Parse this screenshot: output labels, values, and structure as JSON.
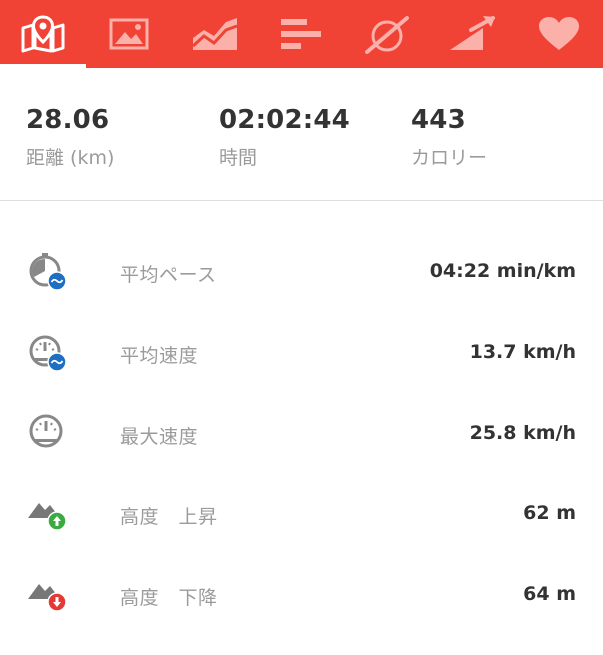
{
  "tabs": [
    {
      "icon": "map-pin-icon",
      "active": true
    },
    {
      "icon": "photo-icon",
      "active": false
    },
    {
      "icon": "area-chart-icon",
      "active": false
    },
    {
      "icon": "splits-bars-icon",
      "active": false
    },
    {
      "icon": "pace-gauge-icon",
      "active": false
    },
    {
      "icon": "elevation-icon",
      "active": false
    },
    {
      "icon": "heart-icon",
      "active": false
    }
  ],
  "colors": {
    "accent": "#f14236",
    "value_text": "#333333",
    "label_text": "#9b9b9b",
    "badge_blue": "#1e6fc2",
    "badge_green": "#3aab3f",
    "badge_red": "#e53935"
  },
  "summary": {
    "distance": {
      "value": "28.06",
      "label": "距離 (km)"
    },
    "time": {
      "value": "02:02:44",
      "label": "時間"
    },
    "calories": {
      "value": "443",
      "label": "カロリー"
    }
  },
  "stats": [
    {
      "icon": "avg-pace-icon",
      "label": "平均ペース",
      "value": "04:22 min/km"
    },
    {
      "icon": "avg-speed-icon",
      "label": "平均速度",
      "value": "13.7 km/h"
    },
    {
      "icon": "max-speed-icon",
      "label": "最大速度",
      "value": "25.8 km/h"
    },
    {
      "icon": "elevation-gain-icon",
      "label": "高度　上昇",
      "value": "62 m"
    },
    {
      "icon": "elevation-loss-icon",
      "label": "高度　下降",
      "value": "64 m"
    }
  ]
}
